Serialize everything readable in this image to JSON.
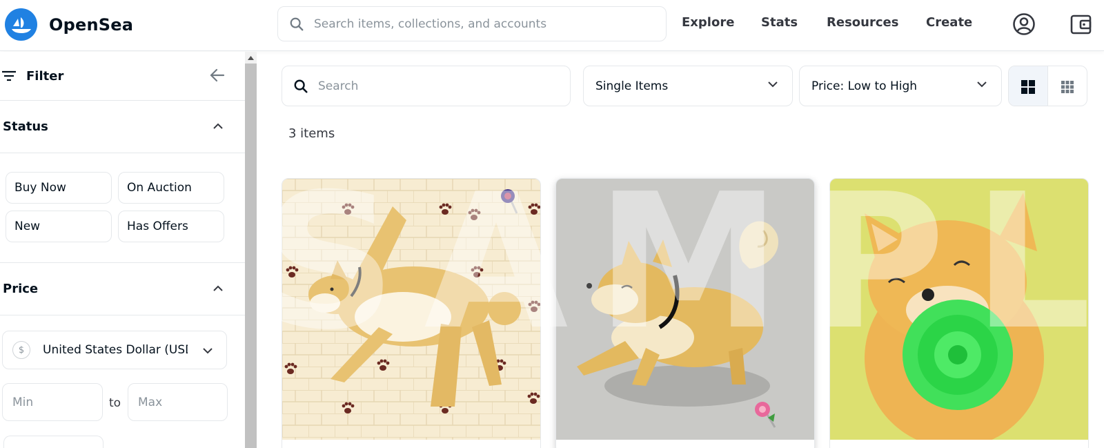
{
  "header": {
    "logo_text": "OpenSea",
    "search_placeholder": "Search items, collections, and accounts",
    "nav": [
      "Explore",
      "Stats",
      "Resources",
      "Create"
    ],
    "icons": [
      "profile-icon",
      "wallet-icon"
    ]
  },
  "sidebar": {
    "filter_label": "Filter",
    "status": {
      "label": "Status",
      "chips": [
        "Buy Now",
        "On Auction",
        "New",
        "Has Offers"
      ]
    },
    "price": {
      "label": "Price",
      "currency": "United States Dollar (USD)",
      "min_placeholder": "Min",
      "to_label": "to",
      "max_placeholder": "Max"
    }
  },
  "main": {
    "search_placeholder": "Search",
    "item_type": "Single Items",
    "sort": "Price: Low to High",
    "count": "3 items",
    "watermark": "SAMPLE"
  },
  "colors": {
    "brand": "#2081e2",
    "border": "#e5e8eb",
    "text": "#04111d",
    "muted": "#8a939b"
  }
}
